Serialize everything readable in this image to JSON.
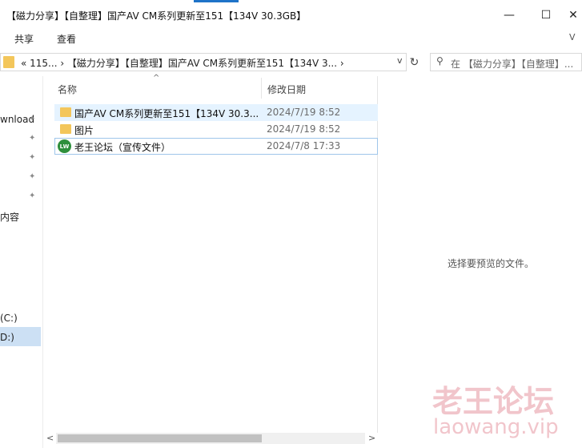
{
  "window": {
    "title": "【磁力分享】【自整理】国产AV CM系列更新至151【134V 30.3GB】",
    "controls": [
      "—",
      "☐",
      "✕"
    ]
  },
  "ribbon": {
    "tabs": [
      "共享",
      "查看"
    ],
    "expand_glyph": "ᐯ"
  },
  "address": {
    "path_text": "«  115...  ›  【磁力分享】【自整理】国产AV CM系列更新至151【134V 3...  ›",
    "dropdown_glyph": "v",
    "refresh_glyph": "↻"
  },
  "search": {
    "icon_glyph": "⚲",
    "placeholder": "在 【磁力分享】【自整理】..."
  },
  "nav": {
    "items": [
      "wnload",
      "内容",
      "(C:)",
      "D:)"
    ],
    "pin_glyph": "✦"
  },
  "list": {
    "headers": {
      "name": "名称",
      "date": "修改日期"
    },
    "sort_glyph": "^",
    "rows": [
      {
        "name": "国产AV CM系列更新至151【134V 30.3...",
        "date": "2024/7/19 8:52",
        "icon": "folder-icon"
      },
      {
        "name": "图片",
        "date": "2024/7/19 8:52",
        "icon": "folder-icon"
      },
      {
        "name": "老王论坛（宣传文件）",
        "date": "2024/7/8 17:33",
        "icon": "site-shortcut-icon"
      }
    ],
    "site_icon_text": "LW"
  },
  "preview": {
    "empty_text": "选择要预览的文件。"
  },
  "scrollbar": {
    "left_glyph": "<",
    "right_glyph": ">"
  },
  "watermark": {
    "title": "老王论坛",
    "url": "laowang.vip"
  }
}
